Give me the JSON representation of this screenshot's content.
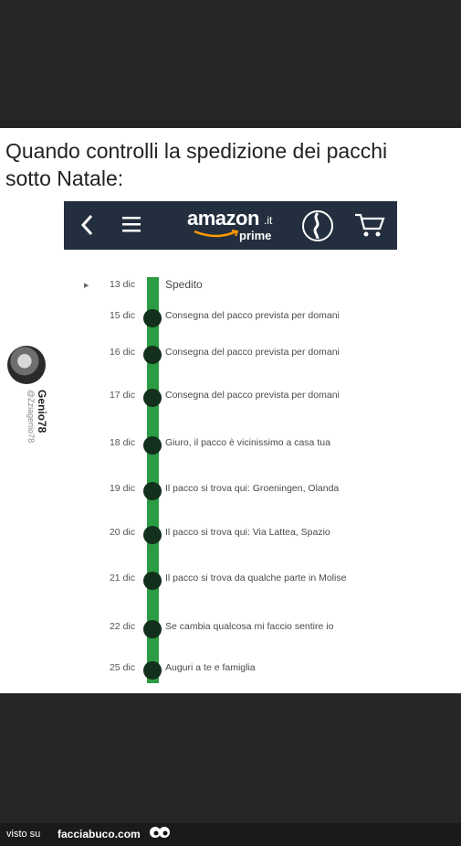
{
  "caption": {
    "line1": "Quando controlli la spedizione dei pacchi",
    "line2": "sotto Natale:"
  },
  "navbar": {
    "brand": "amazon",
    "brand_tld": ".it",
    "brand_sub": "prime",
    "icons": [
      "back-icon",
      "menu-icon",
      "alexa-icon",
      "cart-icon"
    ],
    "background": "#232f3e",
    "accent": "#ff9900"
  },
  "watermark": {
    "name": "Genio78",
    "handle": "@Zziagenio78"
  },
  "timeline": {
    "line_color": "#2c9c44",
    "dot_color": "#12301c",
    "events": [
      {
        "date": "13 dic",
        "text": "Spedito"
      },
      {
        "date": "15 dic",
        "text": "Consegna del pacco prevista per domani"
      },
      {
        "date": "16 dic",
        "text": "Consegna del pacco prevista per domani"
      },
      {
        "date": "17 dic",
        "text": "Consegna del pacco prevista per domani"
      },
      {
        "date": "18 dic",
        "text": "Giuro, il pacco è vicinissimo a casa tua"
      },
      {
        "date": "19 dic",
        "text": "Il pacco si trova qui: Groeningen, Olanda"
      },
      {
        "date": "20 dic",
        "text": "Il pacco si trova qui: Via Lattea, Spazio"
      },
      {
        "date": "21 dic",
        "text": "Il pacco si trova da qualche parte in Molise"
      },
      {
        "date": "22 dic",
        "text": "Se cambia qualcosa mi faccio sentire io"
      },
      {
        "date": "25 dic",
        "text": "Auguri a te e famiglia"
      }
    ]
  },
  "footer": {
    "visto_su": "visto su",
    "site": "facciabuco.com"
  }
}
